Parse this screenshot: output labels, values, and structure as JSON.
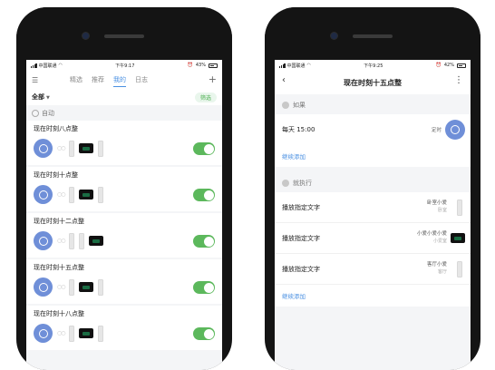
{
  "left": {
    "status": {
      "carrier": "中国联通",
      "time": "下午9:17",
      "battery": "43%"
    },
    "tabs": [
      "精选",
      "推荐",
      "我的",
      "日志"
    ],
    "active_tab": "我的",
    "filter_label": "全部",
    "filter_button": "筛选",
    "section_label": "自动",
    "rules": [
      {
        "title": "现在时刻八点整",
        "device": "screen"
      },
      {
        "title": "现在时刻十点整",
        "device": "screen"
      },
      {
        "title": "现在时刻十二点整",
        "device": "screen"
      },
      {
        "title": "现在时刻十五点整",
        "device": "screen"
      },
      {
        "title": "现在时刻十八点整",
        "device": "screen"
      }
    ]
  },
  "right": {
    "status": {
      "carrier": "中国联通",
      "time": "下午9:25",
      "battery": "42%"
    },
    "title": "现在时刻十五点整",
    "if_label": "如果",
    "condition": {
      "label": "每天 15:00",
      "tag": "定时"
    },
    "add_more": "继续添加",
    "then_label": "就执行",
    "actions": [
      {
        "label": "播放指定文字",
        "device_name": "卧室小爱",
        "room": "卧室",
        "device": "tall"
      },
      {
        "label": "播放指定文字",
        "device_name": "小爱小爱小爱",
        "room": "小爱室",
        "device": "screen"
      },
      {
        "label": "播放指定文字",
        "device_name": "客厅小爱",
        "room": "客厅",
        "device": "tall"
      }
    ],
    "add_more_2": "继续添加"
  }
}
